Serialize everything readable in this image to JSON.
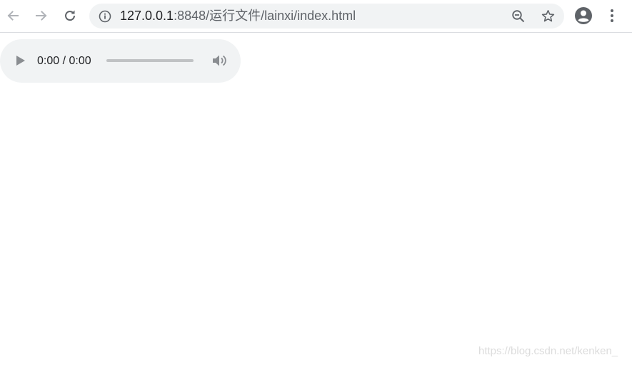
{
  "browser": {
    "url_host": "127.0.0.1",
    "url_rest": ":8848/运行文件/lainxi/index.html",
    "icons": {
      "back": "arrow-left-icon",
      "forward": "arrow-right-icon",
      "reload": "reload-icon",
      "info": "info-icon",
      "zoom": "zoom-out-icon",
      "bookmark": "star-icon",
      "profile": "account-circle-icon",
      "menu": "three-dots-vertical-icon"
    }
  },
  "audio": {
    "time_display": "0:00 / 0:00",
    "progress": 0,
    "icons": {
      "play": "play-icon",
      "volume": "volume-icon"
    }
  },
  "watermark": {
    "text": "https://blog.csdn.net/kenken_"
  },
  "colors": {
    "toolbar_bg": "#ffffff",
    "omnibox_bg": "#f1f3f4",
    "icon_dark": "#5f6368",
    "icon_disabled": "#b0b3b8",
    "player_bg": "#f1f3f4"
  }
}
